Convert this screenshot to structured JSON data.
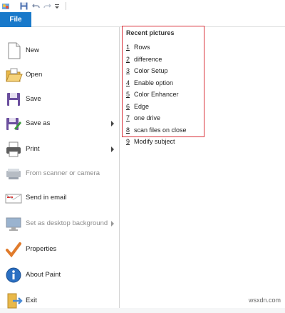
{
  "file_tab": "File",
  "menu": [
    {
      "label": "New",
      "icon": "new-document-icon",
      "submenu": false,
      "enabled": true
    },
    {
      "label": "Open",
      "icon": "open-folder-icon",
      "submenu": false,
      "enabled": true
    },
    {
      "label": "Save",
      "icon": "save-icon",
      "submenu": false,
      "enabled": true
    },
    {
      "label": "Save as",
      "icon": "save-as-icon",
      "submenu": true,
      "enabled": true
    },
    {
      "label": "Print",
      "icon": "printer-icon",
      "submenu": true,
      "enabled": true
    },
    {
      "label": "From scanner or camera",
      "icon": "scanner-icon",
      "submenu": false,
      "enabled": false
    },
    {
      "label": "Send in email",
      "icon": "email-icon",
      "submenu": false,
      "enabled": true
    },
    {
      "label": "Set as desktop background",
      "icon": "desktop-background-icon",
      "submenu": true,
      "enabled": false
    },
    {
      "label": "Properties",
      "icon": "checkmark-icon",
      "submenu": false,
      "enabled": true
    },
    {
      "label": "About Paint",
      "icon": "info-icon",
      "submenu": false,
      "enabled": true
    },
    {
      "label": "Exit",
      "icon": "exit-icon",
      "submenu": false,
      "enabled": true
    }
  ],
  "recent": {
    "title": "Recent pictures",
    "items": [
      {
        "num": "1",
        "name": "Rows"
      },
      {
        "num": "2",
        "name": "difference"
      },
      {
        "num": "3",
        "name": "Color Setup"
      },
      {
        "num": "4",
        "name": "Enable option"
      },
      {
        "num": "5",
        "name": "Color Enhancer"
      },
      {
        "num": "6",
        "name": "Edge"
      },
      {
        "num": "7",
        "name": "one drive"
      },
      {
        "num": "8",
        "name": "scan files on close"
      },
      {
        "num": "9",
        "name": "Modify subject"
      }
    ]
  },
  "watermark": "wsxdn.com",
  "colors": {
    "file_tab": "#1979ca",
    "recent_border": "#d9323a"
  }
}
